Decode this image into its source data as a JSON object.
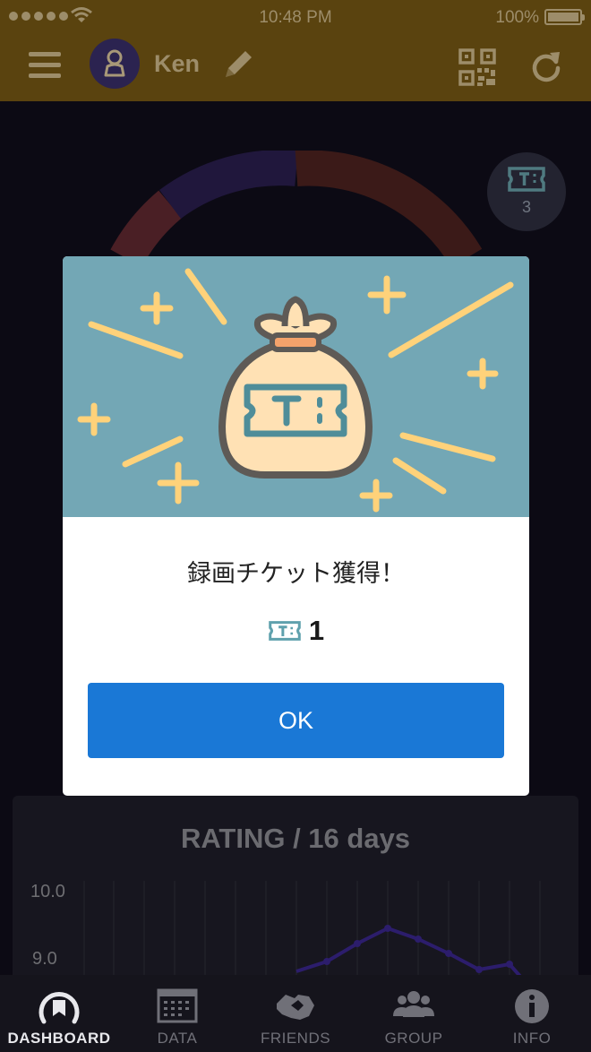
{
  "status_bar": {
    "time": "10:48 PM",
    "battery": "100%"
  },
  "header": {
    "username": "Ken"
  },
  "ticket_badge": {
    "count": "3"
  },
  "rating": {
    "title": "RATING / 16 days",
    "y_labels": [
      "10.0",
      "9.0"
    ]
  },
  "modal": {
    "title": "録画チケット獲得！",
    "reward_count": "1",
    "ok_label": "OK"
  },
  "tabs": [
    {
      "label": "DASHBOARD",
      "icon": "dashboard-icon",
      "active": true
    },
    {
      "label": "DATA",
      "icon": "calendar-icon",
      "active": false
    },
    {
      "label": "FRIENDS",
      "icon": "friends-icon",
      "active": false
    },
    {
      "label": "GROUP",
      "icon": "group-icon",
      "active": false
    },
    {
      "label": "INFO",
      "icon": "info-icon",
      "active": false
    }
  ],
  "colors": {
    "header": "#5a430f",
    "primary": "#1a78d6",
    "banner": "#73a7b5",
    "accent_yellow": "#ffd27a"
  }
}
